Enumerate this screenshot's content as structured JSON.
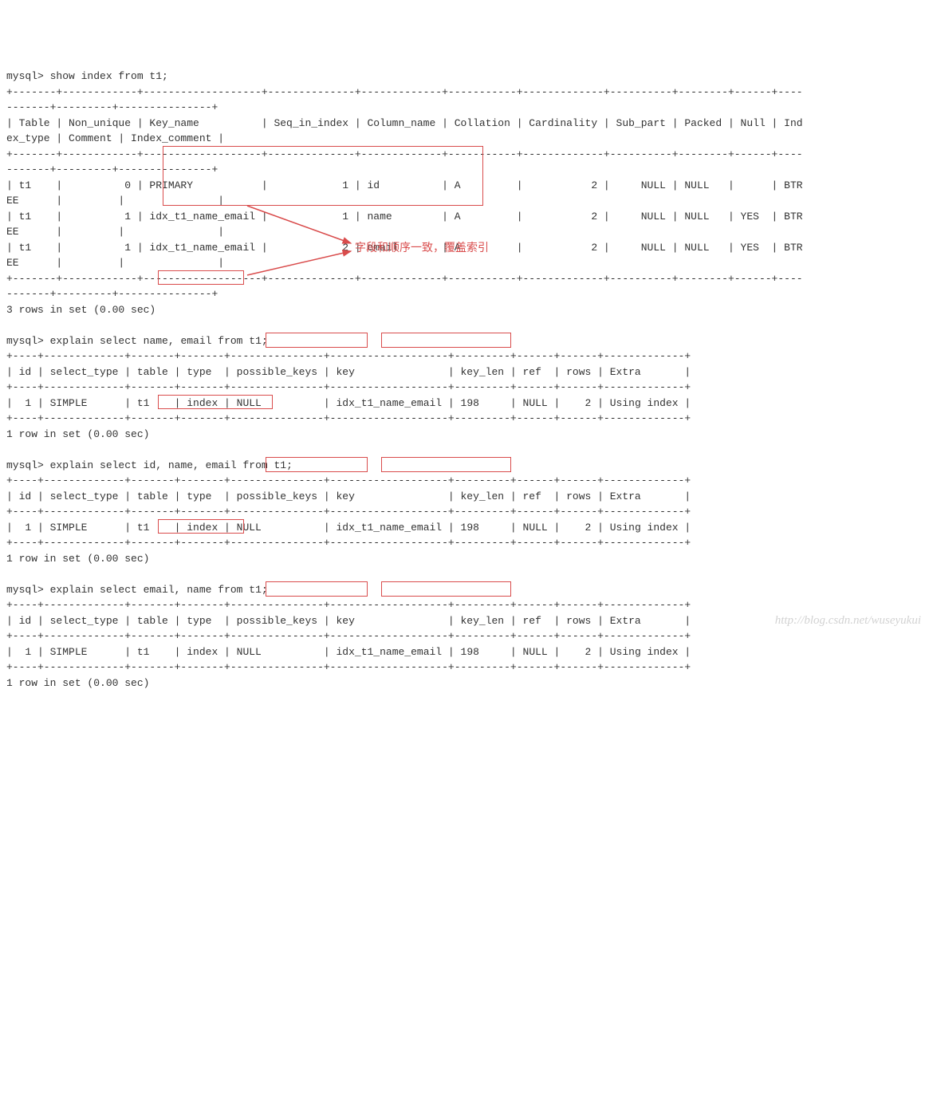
{
  "prompt": "mysql>",
  "commands": {
    "show_index": "show index from t1;",
    "explain1": "explain select name, email from t1;",
    "explain2": "explain select id, name, email from t1;",
    "explain3": "explain select email, name from t1;"
  },
  "segments": {
    "show_index_cmd_pre": "mysql> ",
    "explain1_pre": "mysql> explain select ",
    "explain1_hl": "name, email",
    "explain1_post": " from t1;",
    "explain2_pre": "mysql> explain select ",
    "explain2_hl": "id, name, email",
    "explain2_post": " from t1;",
    "explain3_pre": "mysql> explain select ",
    "explain3_hl": "email, name",
    "explain3_post": " from t1;"
  },
  "index_table": {
    "headers": [
      "Table",
      "Non_unique",
      "Key_name",
      "Seq_in_index",
      "Column_name",
      "Collation",
      "Cardinality",
      "Sub_part",
      "Packed",
      "Null",
      "Index_type",
      "Comment",
      "Index_comment"
    ],
    "rows": [
      {
        "Table": "t1",
        "Non_unique": "0",
        "Key_name": "PRIMARY",
        "Seq_in_index": "1",
        "Column_name": "id",
        "Collation": "A",
        "Cardinality": "2",
        "Sub_part": "NULL",
        "Packed": "NULL",
        "Null": "",
        "Index_type": "BTREE"
      },
      {
        "Table": "t1",
        "Non_unique": "1",
        "Key_name": "idx_t1_name_email",
        "Seq_in_index": "1",
        "Column_name": "name",
        "Collation": "A",
        "Cardinality": "2",
        "Sub_part": "NULL",
        "Packed": "NULL",
        "Null": "YES",
        "Index_type": "BTREE"
      },
      {
        "Table": "t1",
        "Non_unique": "1",
        "Key_name": "idx_t1_name_email",
        "Seq_in_index": "2",
        "Column_name": "email",
        "Collation": "A",
        "Cardinality": "2",
        "Sub_part": "NULL",
        "Packed": "NULL",
        "Null": "YES",
        "Index_type": "BTREE"
      }
    ],
    "footer": "3 rows in set (0.00 sec)"
  },
  "explain_common": {
    "headers": [
      "id",
      "select_type",
      "table",
      "type",
      "possible_keys",
      "key",
      "key_len",
      "ref",
      "rows",
      "Extra"
    ],
    "row": {
      "id": "1",
      "select_type": "SIMPLE",
      "table": "t1",
      "type": "index",
      "possible_keys": "NULL",
      "key": "idx_t1_name_email",
      "key_len": "198",
      "ref": "NULL",
      "rows": "2",
      "Extra": "Using index"
    },
    "footer": "1 row in set (0.00 sec)"
  },
  "annotation": "字段和顺序一致，覆盖索引",
  "watermark": "http://blog.csdn.net/wuseyukui",
  "raw": {
    "index_border_top": "+-------+------------+-------------------+--------------+-------------+-----------+-------------+----------+--------+------+----",
    "index_border_cont": "-------+---------+---------------+",
    "index_header_l1": "| Table | Non_unique | Key_name          | Seq_in_index | Column_name | Collation | Cardinality | Sub_part | Packed | Null | Ind",
    "index_header_l2": "ex_type | Comment | Index_comment |",
    "index_row1_l1": "| t1    |          0 | PRIMARY           |            1 | id          | A         |           2 |     NULL | NULL   |      | BTR",
    "index_row1_l2": "EE      |         |               |",
    "index_row2_l1": "| t1    |          1 | idx_t1_name_email |            1 | name        | A         |           2 |     NULL | NULL   | YES  | BTR",
    "index_row2_l2": "EE      |         |               |",
    "index_row3_l1": "| t1    |          1 | idx_t1_name_email |            2 | email       | A         |           2 |     NULL | NULL   | YES  | BTR",
    "index_row3_l2": "EE      |         |               |",
    "explain_border": "+----+-------------+-------+-------+---------------+-------------------+---------+------+------+-------------+",
    "explain_header": "| id | select_type | table | type  | possible_keys | key               | key_len | ref  | rows | Extra       |",
    "explain_row_pre": "|  1 | SIMPLE      | t1    | index | ",
    "explain_row_null": "NULL         ",
    "explain_row_mid": " | ",
    "explain_row_key": "idx_t1_name_email",
    "explain_row_post": " | 198     | NULL |    2 | Using index |"
  }
}
